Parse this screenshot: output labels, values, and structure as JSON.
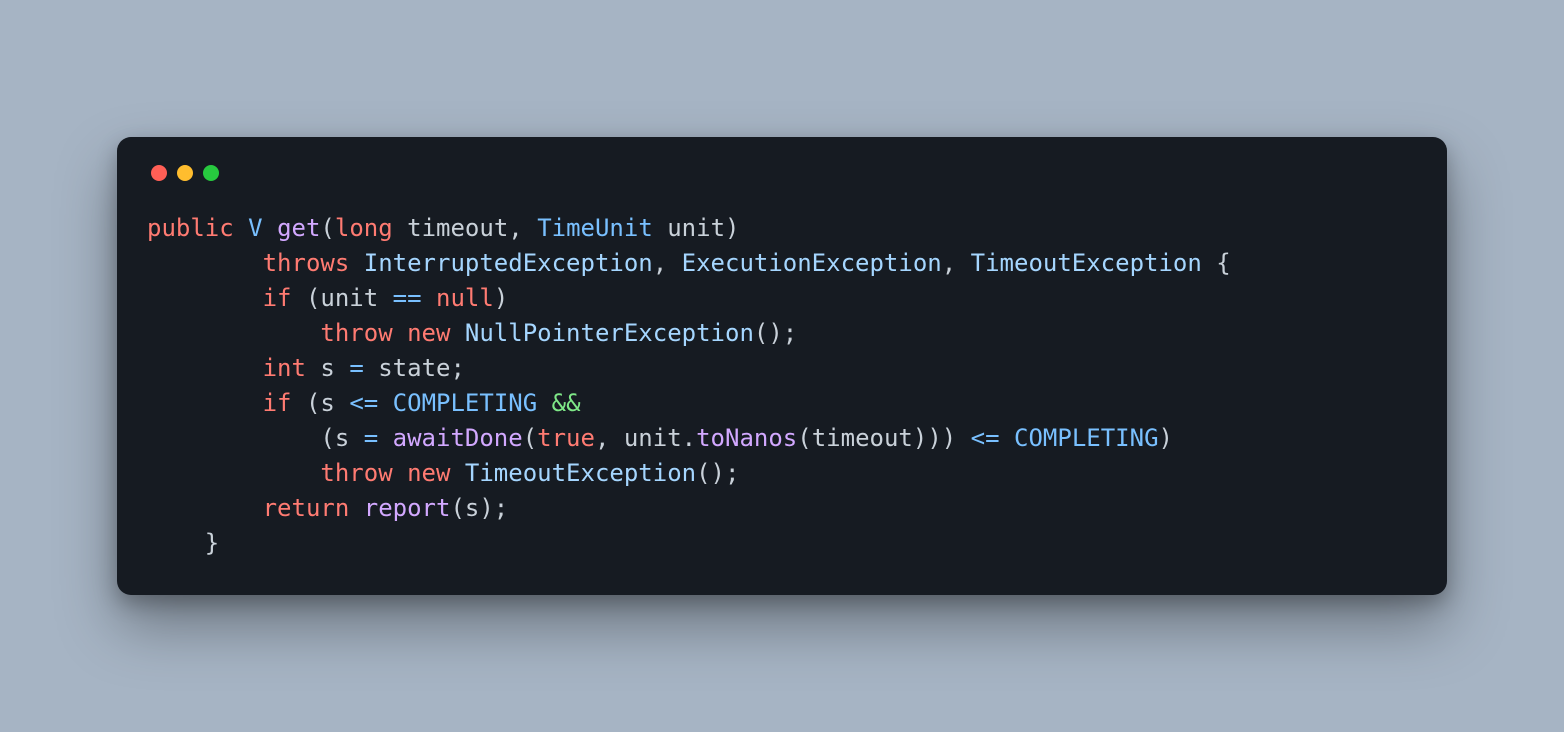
{
  "colors": {
    "background": "#a6b4c4",
    "card": "#161b22",
    "text": "#c9d1d9",
    "keyword": "#ff7b72",
    "type": "#79c0ff",
    "function": "#d2a8ff",
    "exception": "#a5d6ff",
    "constant": "#79c0ff",
    "literal": "#ff7b72",
    "ampersand": "#7ee787",
    "dot_red": "#ff5f56",
    "dot_yellow": "#ffbd2e",
    "dot_green": "#27c93f"
  },
  "code": {
    "language": "java",
    "lines": [
      [
        {
          "t": "public",
          "c": "k"
        },
        {
          "t": " ",
          "c": "p"
        },
        {
          "t": "V",
          "c": "t"
        },
        {
          "t": " ",
          "c": "p"
        },
        {
          "t": "get",
          "c": "fn"
        },
        {
          "t": "(",
          "c": "p"
        },
        {
          "t": "long",
          "c": "kt"
        },
        {
          "t": " ",
          "c": "p"
        },
        {
          "t": "timeout",
          "c": "id"
        },
        {
          "t": ", ",
          "c": "p"
        },
        {
          "t": "TimeUnit",
          "c": "t"
        },
        {
          "t": " ",
          "c": "p"
        },
        {
          "t": "unit",
          "c": "id"
        },
        {
          "t": ")",
          "c": "p"
        }
      ],
      [
        {
          "t": "        ",
          "c": "p"
        },
        {
          "t": "throws",
          "c": "k"
        },
        {
          "t": " ",
          "c": "p"
        },
        {
          "t": "InterruptedException",
          "c": "typ"
        },
        {
          "t": ", ",
          "c": "p"
        },
        {
          "t": "ExecutionException",
          "c": "typ"
        },
        {
          "t": ", ",
          "c": "p"
        },
        {
          "t": "TimeoutException",
          "c": "typ"
        },
        {
          "t": " ",
          "c": "p"
        },
        {
          "t": "{",
          "c": "br"
        }
      ],
      [
        {
          "t": "        ",
          "c": "p"
        },
        {
          "t": "if",
          "c": "k"
        },
        {
          "t": " (",
          "c": "p"
        },
        {
          "t": "unit",
          "c": "id"
        },
        {
          "t": " ",
          "c": "p"
        },
        {
          "t": "==",
          "c": "op"
        },
        {
          "t": " ",
          "c": "p"
        },
        {
          "t": "null",
          "c": "lit"
        },
        {
          "t": ")",
          "c": "p"
        }
      ],
      [
        {
          "t": "            ",
          "c": "p"
        },
        {
          "t": "throw",
          "c": "k"
        },
        {
          "t": " ",
          "c": "p"
        },
        {
          "t": "new",
          "c": "k"
        },
        {
          "t": " ",
          "c": "p"
        },
        {
          "t": "NullPointerException",
          "c": "typ"
        },
        {
          "t": "();",
          "c": "p"
        }
      ],
      [
        {
          "t": "        ",
          "c": "p"
        },
        {
          "t": "int",
          "c": "kt"
        },
        {
          "t": " ",
          "c": "p"
        },
        {
          "t": "s",
          "c": "id"
        },
        {
          "t": " ",
          "c": "p"
        },
        {
          "t": "=",
          "c": "op"
        },
        {
          "t": " ",
          "c": "p"
        },
        {
          "t": "state",
          "c": "id"
        },
        {
          "t": ";",
          "c": "p"
        }
      ],
      [
        {
          "t": "        ",
          "c": "p"
        },
        {
          "t": "if",
          "c": "k"
        },
        {
          "t": " (",
          "c": "p"
        },
        {
          "t": "s",
          "c": "id"
        },
        {
          "t": " ",
          "c": "p"
        },
        {
          "t": "<=",
          "c": "op"
        },
        {
          "t": " ",
          "c": "p"
        },
        {
          "t": "COMPLETING",
          "c": "ct"
        },
        {
          "t": " ",
          "c": "p"
        },
        {
          "t": "&&",
          "c": "amp"
        }
      ],
      [
        {
          "t": "            (",
          "c": "p"
        },
        {
          "t": "s",
          "c": "id"
        },
        {
          "t": " ",
          "c": "p"
        },
        {
          "t": "=",
          "c": "op"
        },
        {
          "t": " ",
          "c": "p"
        },
        {
          "t": "awaitDone",
          "c": "fn"
        },
        {
          "t": "(",
          "c": "p"
        },
        {
          "t": "true",
          "c": "lit"
        },
        {
          "t": ", ",
          "c": "p"
        },
        {
          "t": "unit",
          "c": "id"
        },
        {
          "t": ".",
          "c": "p"
        },
        {
          "t": "toNanos",
          "c": "fn"
        },
        {
          "t": "(",
          "c": "p"
        },
        {
          "t": "timeout",
          "c": "id"
        },
        {
          "t": "))) ",
          "c": "p"
        },
        {
          "t": "<=",
          "c": "op"
        },
        {
          "t": " ",
          "c": "p"
        },
        {
          "t": "COMPLETING",
          "c": "ct"
        },
        {
          "t": ")",
          "c": "p"
        }
      ],
      [
        {
          "t": "            ",
          "c": "p"
        },
        {
          "t": "throw",
          "c": "k"
        },
        {
          "t": " ",
          "c": "p"
        },
        {
          "t": "new",
          "c": "k"
        },
        {
          "t": " ",
          "c": "p"
        },
        {
          "t": "TimeoutException",
          "c": "typ"
        },
        {
          "t": "();",
          "c": "p"
        }
      ],
      [
        {
          "t": "        ",
          "c": "p"
        },
        {
          "t": "return",
          "c": "k"
        },
        {
          "t": " ",
          "c": "p"
        },
        {
          "t": "report",
          "c": "fn"
        },
        {
          "t": "(",
          "c": "p"
        },
        {
          "t": "s",
          "c": "id"
        },
        {
          "t": ");",
          "c": "p"
        }
      ],
      [
        {
          "t": "    ",
          "c": "p"
        },
        {
          "t": "}",
          "c": "br"
        }
      ]
    ]
  }
}
